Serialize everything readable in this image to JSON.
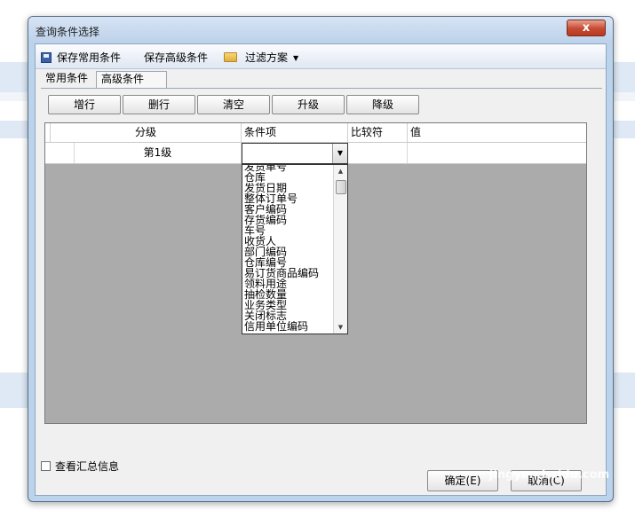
{
  "window": {
    "title": "查询条件选择",
    "close_label": "x"
  },
  "toolbar": {
    "save_common": "保存常用条件",
    "save_advanced": "保存高级条件",
    "filter_scheme": "过滤方案"
  },
  "tabs": [
    {
      "label": "常用条件",
      "active": false
    },
    {
      "label": "高级条件",
      "active": true
    }
  ],
  "actions": {
    "add": "增行",
    "delete": "删行",
    "clear": "清空",
    "upgrade": "升级",
    "downgrade": "降级"
  },
  "grid": {
    "headers": {
      "level": "分级",
      "field": "条件项",
      "operator": "比较符",
      "value": "值"
    },
    "rows": [
      {
        "level": "第1级",
        "field": "",
        "operator": "",
        "value": ""
      }
    ]
  },
  "dropdown": {
    "options": [
      "发货单号",
      "仓库",
      "发货日期",
      "整体订单号",
      "客户编码",
      "存货编码",
      "车号",
      "收货人",
      "部门编码",
      "仓库编号",
      "易订货商品编码",
      "领料用途",
      "抽检数量",
      "业务类型",
      "关闭标志",
      "信用单位编码"
    ]
  },
  "footer": {
    "summary_checkbox": "查看汇总信息",
    "summary_checked": false,
    "ok": "确定(E)",
    "cancel": "取消(C)"
  },
  "watermark": "jingyan.baidu.com"
}
